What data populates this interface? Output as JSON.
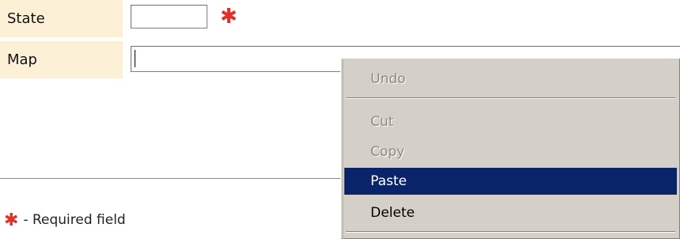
{
  "form": {
    "state_label": "State",
    "state_value": "",
    "map_label": "Map",
    "map_value": "",
    "required_mark": "✱"
  },
  "footer": {
    "required_mark": "✱",
    "required_note": "- Required field"
  },
  "context_menu": {
    "items": [
      {
        "label": "Undo",
        "enabled": false,
        "selected": false
      },
      {
        "label": "Cut",
        "enabled": false,
        "selected": false
      },
      {
        "label": "Copy",
        "enabled": false,
        "selected": false
      },
      {
        "label": "Paste",
        "enabled": true,
        "selected": true
      },
      {
        "label": "Delete",
        "enabled": true,
        "selected": false
      }
    ],
    "highlight_color": "#0a246a",
    "menu_color": "#d4d0c8"
  },
  "colors": {
    "label_background": "#fcf0d6",
    "required": "#e0322a"
  }
}
